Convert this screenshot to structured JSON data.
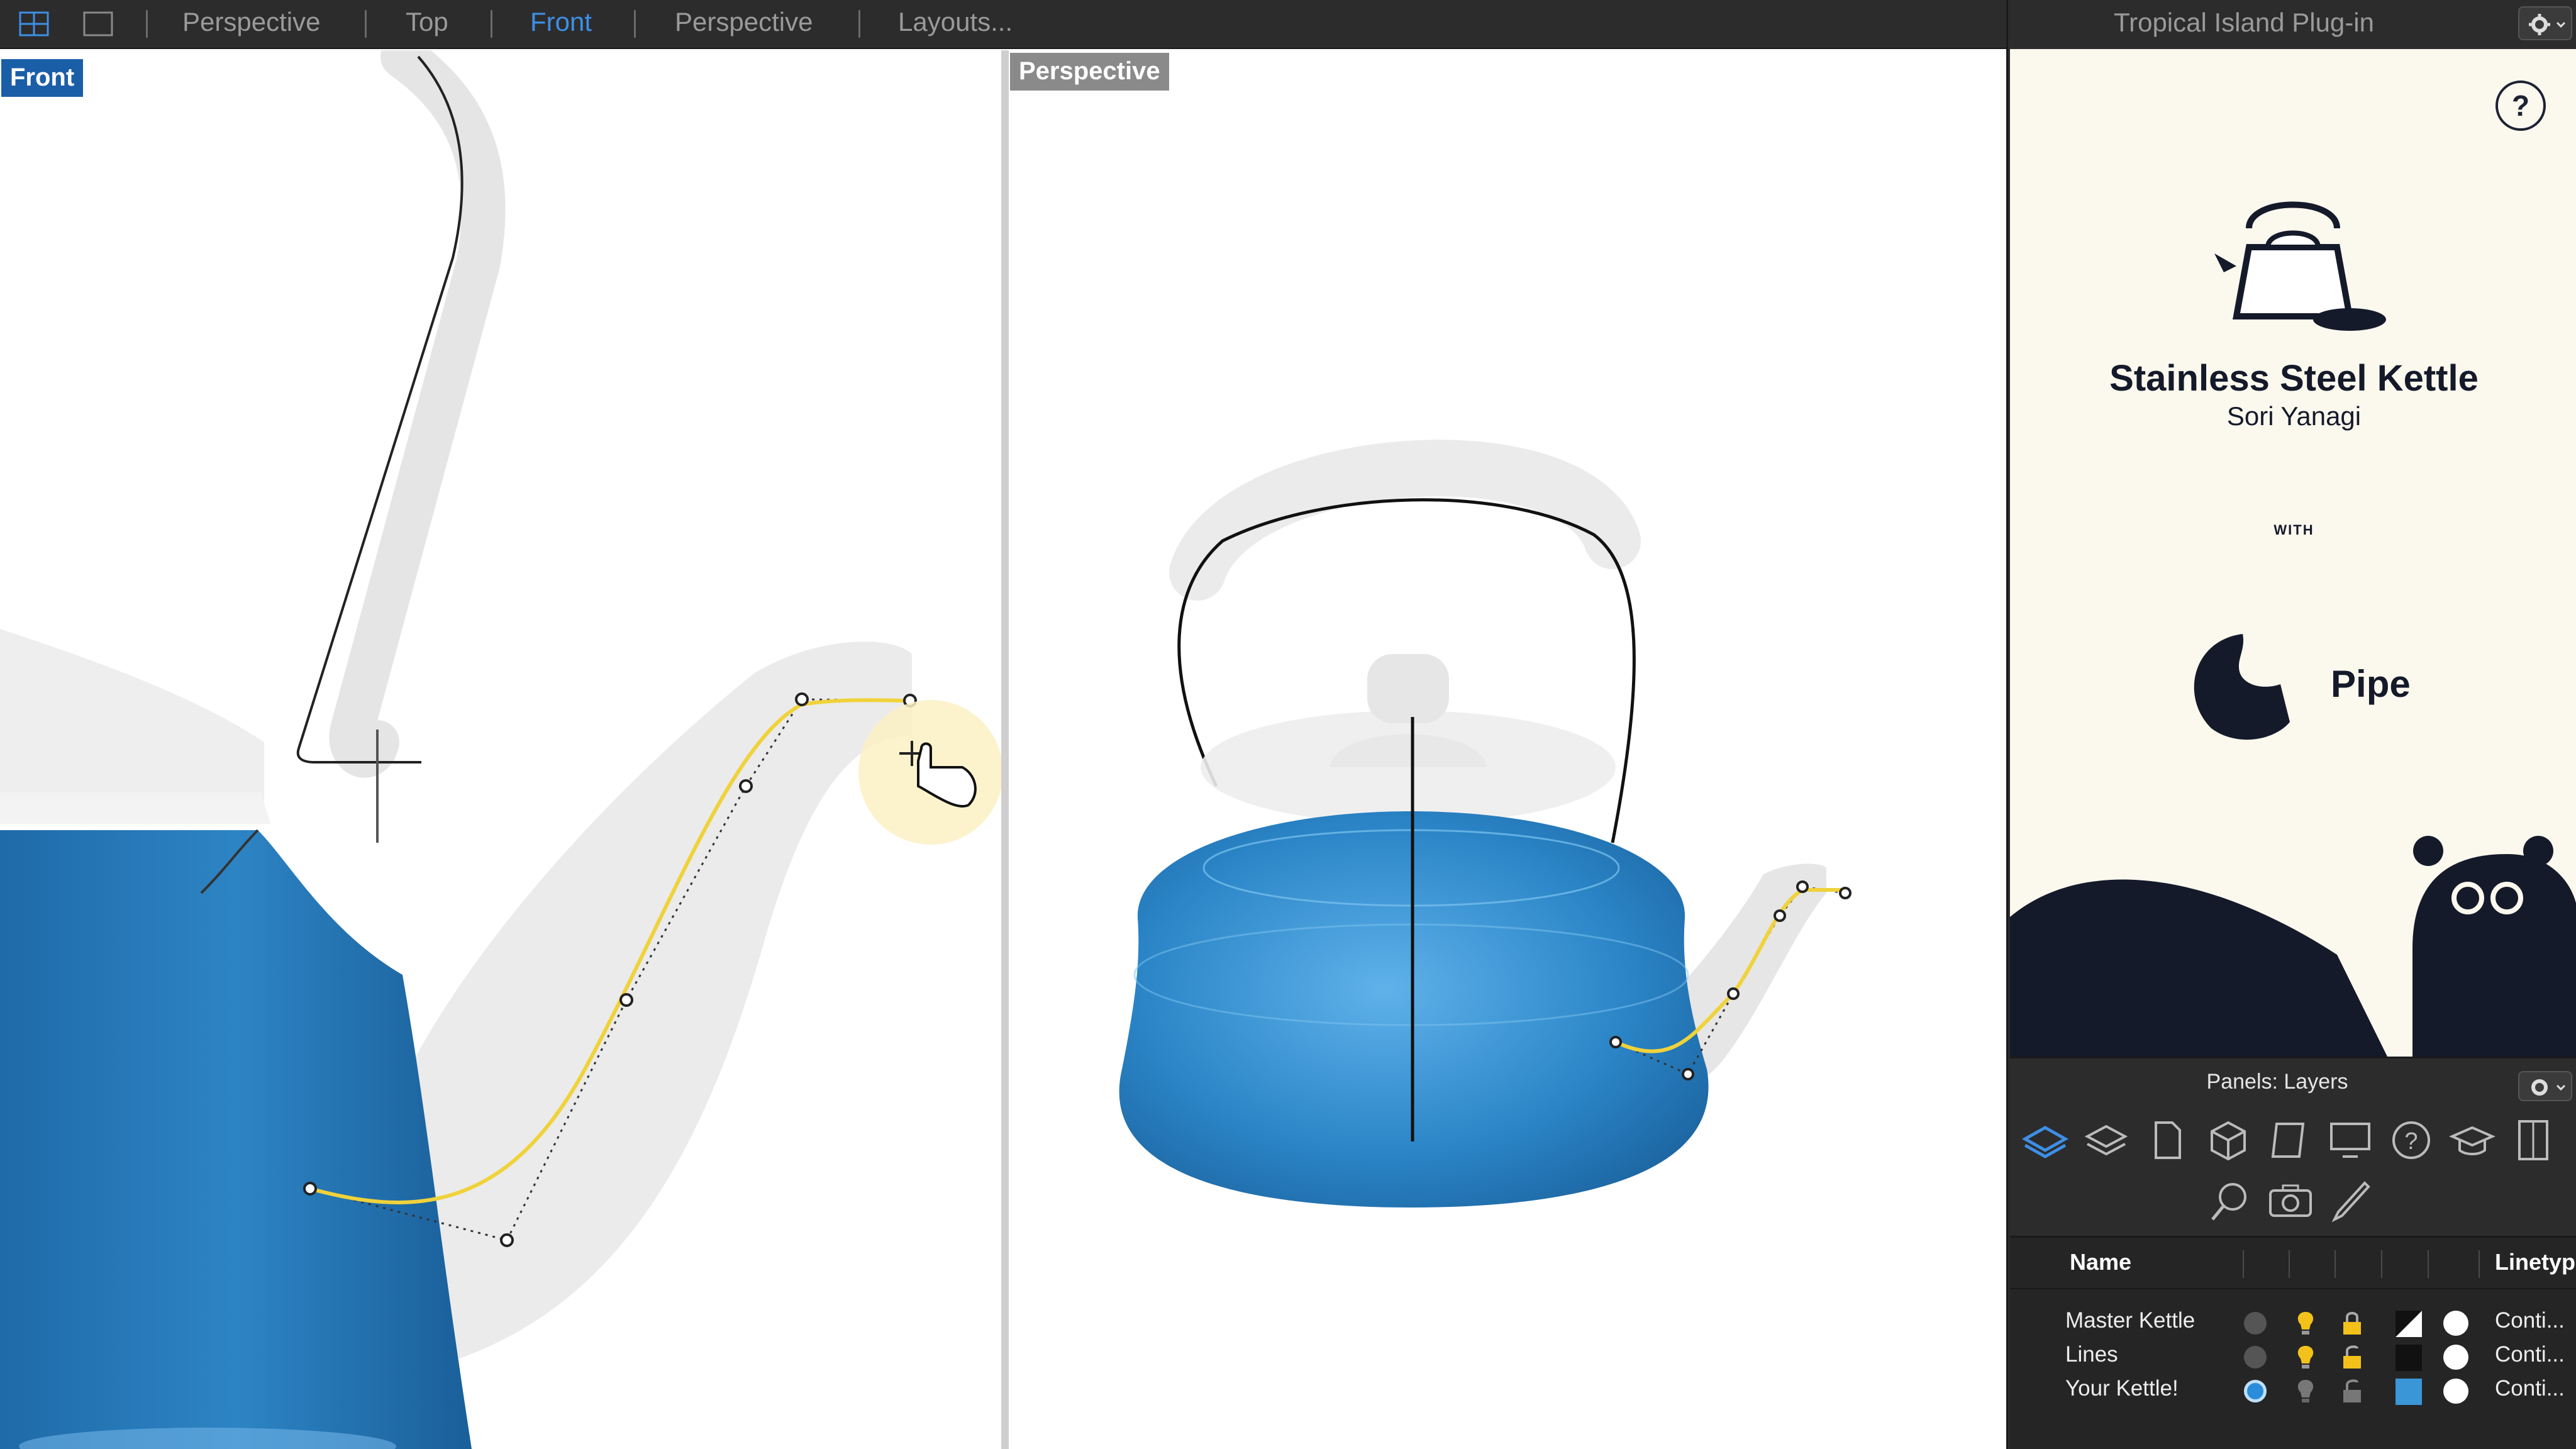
{
  "toolbar": {
    "tabs": [
      {
        "label": "Perspective",
        "active": false
      },
      {
        "label": "Top",
        "active": false
      },
      {
        "label": "Front",
        "active": true
      },
      {
        "label": "Perspective",
        "active": false
      },
      {
        "label": "Layouts...",
        "active": false
      }
    ],
    "icons": [
      "viewport-grid-icon",
      "single-viewport-icon"
    ],
    "active_color": "#3d8fe6"
  },
  "viewports": {
    "front": {
      "label": "Front"
    },
    "perspective": {
      "label": "Perspective"
    }
  },
  "plugin": {
    "title": "Tropical Island Plug-in",
    "help": "?",
    "product": {
      "title": "Stainless Steel Kettle",
      "author": "Sori Yanagi"
    },
    "with_label": "WITH",
    "tool": {
      "name": "Pipe"
    },
    "colors": {
      "background": "#fbf8ee",
      "ink": "#151a2a"
    }
  },
  "panels": {
    "title": "Panels: Layers",
    "icons": [
      "layers-icon",
      "properties-icon",
      "document-icon",
      "object-icon",
      "notes-icon",
      "display-icon",
      "help-icon",
      "learn-icon",
      "named-views-icon",
      "search-icon",
      "camera-icon",
      "render-icon"
    ]
  },
  "layers": {
    "columns": {
      "name": "Name",
      "linetype": "Linetyp"
    },
    "rows": [
      {
        "name": "Master Kettle",
        "current": false,
        "color": "#111111",
        "swatch": "half",
        "linetype": "Conti..."
      },
      {
        "name": "Lines",
        "current": false,
        "color": "#111111",
        "swatch": "solid",
        "linetype": "Conti..."
      },
      {
        "name": "Your Kettle!",
        "current": true,
        "color": "#3a96d6",
        "swatch": "solid",
        "linetype": "Conti..."
      }
    ]
  },
  "model": {
    "color": "#2a7fbf",
    "curve_color": "#f0d23a"
  }
}
